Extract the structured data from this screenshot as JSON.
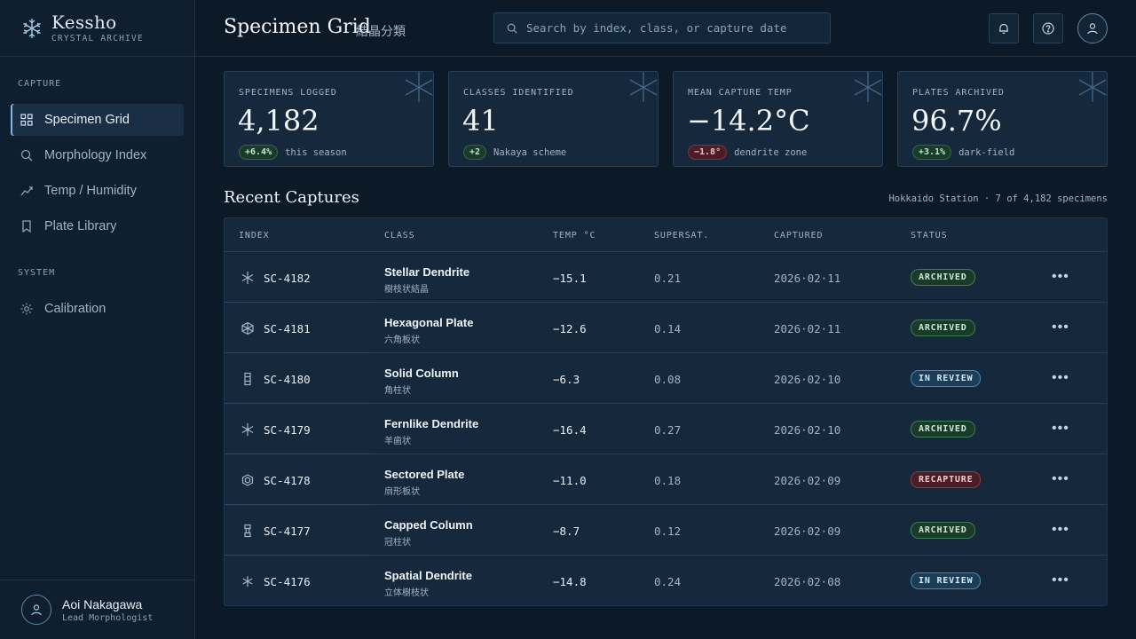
{
  "brand": {
    "name": "Kessho",
    "subtitle": "CRYSTAL ARCHIVE"
  },
  "sidebar": {
    "sections": [
      {
        "label": "CAPTURE"
      },
      {
        "label": "SYSTEM"
      }
    ],
    "items": [
      {
        "label": "Specimen Grid",
        "icon": "grid-icon",
        "active": true
      },
      {
        "label": "Morphology Index",
        "icon": "search-icon"
      },
      {
        "label": "Temp / Humidity",
        "icon": "trend-icon"
      },
      {
        "label": "Plate Library",
        "icon": "bookmark-icon"
      },
      {
        "label": "Calibration",
        "icon": "sun-gear-icon"
      }
    ]
  },
  "user": {
    "name": "Aoi Nakagawa",
    "role": "Lead Morphologist"
  },
  "header": {
    "title": "Specimen Grid",
    "title_jp": "結晶分類",
    "search_placeholder": "Search by index, class, or capture date"
  },
  "stats": [
    {
      "label": "SPECIMENS LOGGED",
      "value": "4,182",
      "delta": "+6.4%",
      "trend": "pos",
      "note": "this season"
    },
    {
      "label": "CLASSES IDENTIFIED",
      "value": "41",
      "delta": "+2",
      "trend": "pos",
      "note": "Nakaya scheme"
    },
    {
      "label": "MEAN CAPTURE TEMP",
      "value": "−14.2°C",
      "delta": "−1.8°",
      "trend": "neg",
      "note": "dendrite zone"
    },
    {
      "label": "PLATES ARCHIVED",
      "value": "96.7%",
      "delta": "+3.1%",
      "trend": "pos",
      "note": "dark-field"
    }
  ],
  "recent": {
    "title": "Recent Captures",
    "meta": "Hokkaido Station · 7 of 4,182 specimens",
    "columns": [
      "INDEX",
      "CLASS",
      "TEMP °C",
      "SUPERSAT.",
      "CAPTURED",
      "STATUS"
    ],
    "rows": [
      {
        "index": "SC-4182",
        "icon": "stellar-icon",
        "class": "Stellar Dendrite",
        "class_jp": "樹枝状結晶",
        "temp": "−15.1",
        "supersat": "0.21",
        "captured": "2026·02·11",
        "status": "ARCHIVED",
        "status_kind": "archived"
      },
      {
        "index": "SC-4181",
        "icon": "hex-plate-icon",
        "class": "Hexagonal Plate",
        "class_jp": "六角板状",
        "temp": "−12.6",
        "supersat": "0.14",
        "captured": "2026·02·11",
        "status": "ARCHIVED",
        "status_kind": "archived"
      },
      {
        "index": "SC-4180",
        "icon": "column-icon",
        "class": "Solid Column",
        "class_jp": "角柱状",
        "temp": "−6.3",
        "supersat": "0.08",
        "captured": "2026·02·10",
        "status": "IN REVIEW",
        "status_kind": "review"
      },
      {
        "index": "SC-4179",
        "icon": "fern-icon",
        "class": "Fernlike Dendrite",
        "class_jp": "羊歯状",
        "temp": "−16.4",
        "supersat": "0.27",
        "captured": "2026·02·10",
        "status": "ARCHIVED",
        "status_kind": "archived"
      },
      {
        "index": "SC-4178",
        "icon": "sectored-icon",
        "class": "Sectored Plate",
        "class_jp": "扇形板状",
        "temp": "−11.0",
        "supersat": "0.18",
        "captured": "2026·02·09",
        "status": "RECAPTURE",
        "status_kind": "recapture"
      },
      {
        "index": "SC-4177",
        "icon": "capped-column-icon",
        "class": "Capped Column",
        "class_jp": "冠柱状",
        "temp": "−8.7",
        "supersat": "0.12",
        "captured": "2026·02·09",
        "status": "ARCHIVED",
        "status_kind": "archived"
      },
      {
        "index": "SC-4176",
        "icon": "spatial-icon",
        "class": "Spatial Dendrite",
        "class_jp": "立体樹枝状",
        "temp": "−14.8",
        "supersat": "0.24",
        "captured": "2026·02·08",
        "status": "IN REVIEW",
        "status_kind": "review"
      }
    ],
    "row_action_label": "•••"
  },
  "colors": {
    "accent": "#7fb9e3",
    "background": "#0c1a28",
    "archived": "#3c7d55",
    "review": "#4a88b0",
    "recapture": "#8e3a4a"
  }
}
